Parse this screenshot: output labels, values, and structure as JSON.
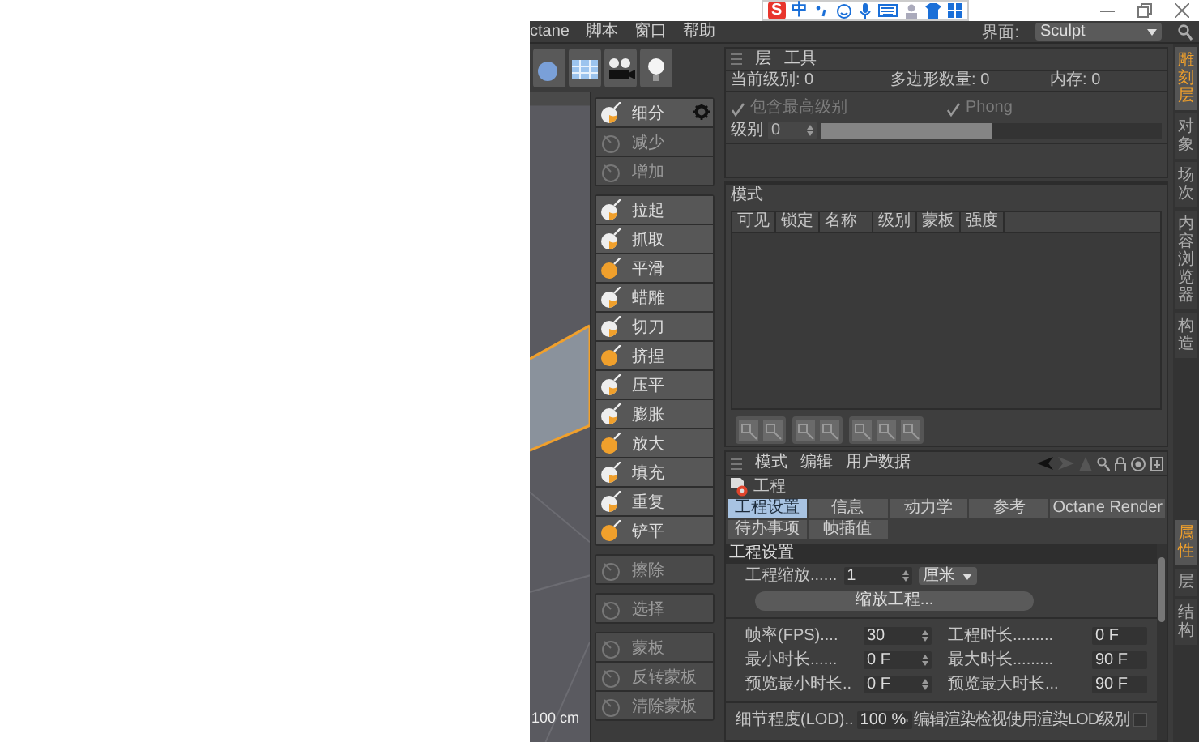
{
  "ime_toolbar": {
    "logo": "S",
    "mode": "中"
  },
  "menu": [
    "ctane",
    "脚本",
    "窗口",
    "帮助"
  ],
  "layout_selector": {
    "label": "界面:",
    "value": "Sculpt"
  },
  "viewport": {
    "scale": "100 cm"
  },
  "sculpt_tools": [
    {
      "items": [
        {
          "label": "细分",
          "disabled": false,
          "has_settings": true
        },
        {
          "label": "减少",
          "disabled": true,
          "has_settings": false
        },
        {
          "label": "增加",
          "disabled": true,
          "has_settings": false
        }
      ]
    },
    {
      "items": [
        {
          "label": "拉起",
          "disabled": false,
          "has_settings": false
        },
        {
          "label": "抓取",
          "disabled": false,
          "has_settings": false
        },
        {
          "label": "平滑",
          "disabled": false,
          "has_settings": false
        },
        {
          "label": "蜡雕",
          "disabled": false,
          "has_settings": false
        },
        {
          "label": "切刀",
          "disabled": false,
          "has_settings": false
        },
        {
          "label": "挤捏",
          "disabled": false,
          "has_settings": false
        },
        {
          "label": "压平",
          "disabled": false,
          "has_settings": false
        },
        {
          "label": "膨胀",
          "disabled": false,
          "has_settings": false
        },
        {
          "label": "放大",
          "disabled": false,
          "has_settings": false
        },
        {
          "label": "填充",
          "disabled": false,
          "has_settings": false
        },
        {
          "label": "重复",
          "disabled": false,
          "has_settings": false
        },
        {
          "label": "铲平",
          "disabled": false,
          "has_settings": false
        }
      ]
    },
    {
      "items": [
        {
          "label": "擦除",
          "disabled": true,
          "has_settings": false
        }
      ]
    },
    {
      "items": [
        {
          "label": "选择",
          "disabled": true,
          "has_settings": false
        }
      ]
    },
    {
      "items": [
        {
          "label": "蒙板",
          "disabled": true,
          "has_settings": false
        },
        {
          "label": "反转蒙板",
          "disabled": true,
          "has_settings": false
        },
        {
          "label": "清除蒙板",
          "disabled": true,
          "has_settings": false
        }
      ]
    }
  ],
  "layers_panel": {
    "tabs": [
      "层",
      "工具"
    ],
    "stats": [
      {
        "label": "当前级别: 0"
      },
      {
        "label": "多边形数量: 0"
      },
      {
        "label": "内存: 0"
      }
    ],
    "options": [
      {
        "label": "包含最高级别",
        "checked": true,
        "disabled": true
      },
      {
        "label": "Phong",
        "checked": true,
        "disabled": true
      }
    ],
    "level": {
      "label": "级别",
      "value": "0",
      "level": 0.5
    },
    "mode_label": "模式",
    "columns": [
      "可见",
      "锁定",
      "名称",
      "级别",
      "蒙板",
      "强度"
    ]
  },
  "attributes": {
    "menu": [
      "模式",
      "编辑",
      "用户数据"
    ],
    "object": "工程",
    "tabs": [
      {
        "label": "工程设置",
        "selected": true
      },
      {
        "label": "信息",
        "selected": false
      },
      {
        "label": "动力学",
        "selected": false
      },
      {
        "label": "参考",
        "selected": false
      },
      {
        "label": "Octane Render",
        "selected": false
      },
      {
        "label": "待办事项",
        "selected": false
      },
      {
        "label": "帧插值",
        "selected": false
      }
    ],
    "section": "工程设置",
    "scale": {
      "label": "工程缩放......",
      "value": "1",
      "unit": "厘米"
    },
    "scale_button": "缩放工程...",
    "fields": [
      {
        "label": "帧率(FPS)....",
        "value": "30"
      },
      {
        "label": "工程时长.........",
        "value": "0 F"
      },
      {
        "label": "最小时长......",
        "value": "0 F"
      },
      {
        "label": "最大时长.........",
        "value": "90 F"
      },
      {
        "label": "预览最小时长..",
        "value": "0 F"
      },
      {
        "label": "预览最大时长...",
        "value": "90 F"
      }
    ],
    "lod": {
      "label": "细节程度(LOD)..",
      "value": "100 %"
    },
    "lod_option": {
      "label": "编辑渲染检视使用渲染LOD级别",
      "checked": false
    }
  },
  "side_tabs_top": [
    {
      "label": "雕刻层",
      "selected": true
    },
    {
      "label": "对象",
      "selected": false
    },
    {
      "label": "场次",
      "selected": false
    },
    {
      "label": "内容浏览器",
      "selected": false
    },
    {
      "label": "构造",
      "selected": false
    }
  ],
  "side_tabs_bottom": [
    {
      "label": "属性",
      "selected": true
    },
    {
      "label": "层",
      "selected": false
    },
    {
      "label": "结构",
      "selected": false
    }
  ]
}
